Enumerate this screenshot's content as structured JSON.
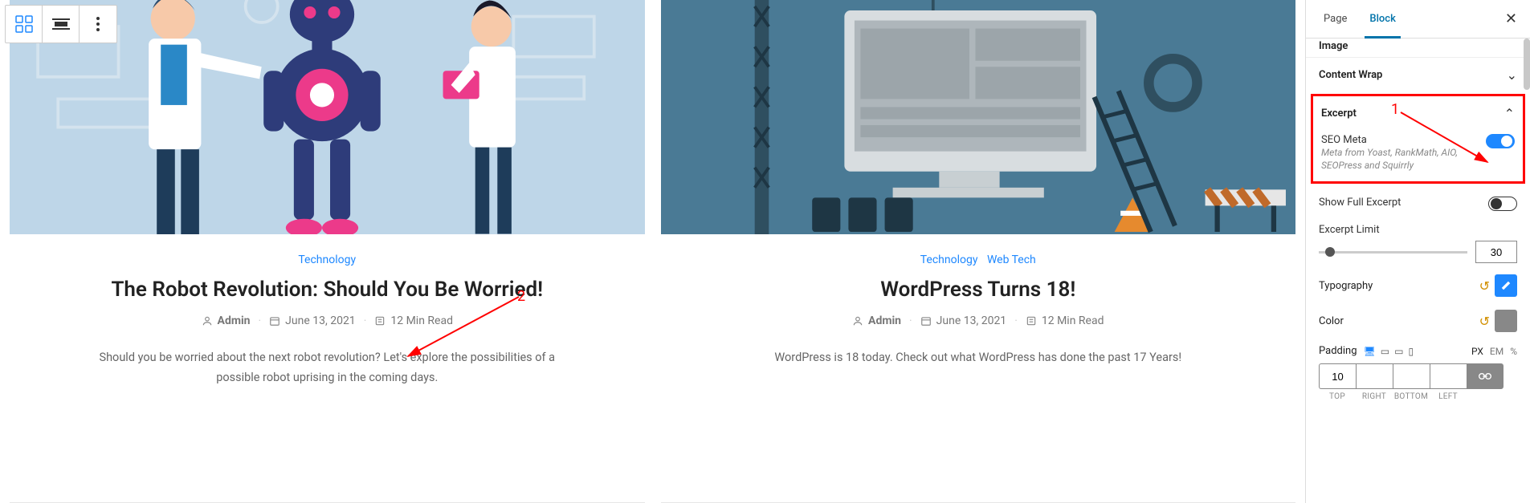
{
  "toolbar": {
    "grid_view": "grid-blocks-icon",
    "fill_view": "fill-width-icon",
    "more": "more-options-icon"
  },
  "posts": [
    {
      "categories": [
        "Technology"
      ],
      "title": "The Robot Revolution: Should You Be Worried!",
      "author": "Admin",
      "date": "June 13, 2021",
      "read_time": "12 Min Read",
      "excerpt": "Should you be worried about the next robot revolution? Let's explore the possibilities of a possible robot uprising in the coming days."
    },
    {
      "categories": [
        "Technology",
        "Web Tech"
      ],
      "title": "WordPress Turns 18!",
      "author": "Admin",
      "date": "June 13, 2021",
      "read_time": "12 Min Read",
      "excerpt": "WordPress is 18 today. Check out what WordPress has done the past 17 Years!"
    }
  ],
  "sidebar": {
    "tabs": {
      "page": "Page",
      "block": "Block"
    },
    "sections": {
      "image": "Image",
      "content_wrap": "Content Wrap",
      "excerpt": "Excerpt"
    },
    "seo_meta": {
      "label": "SEO Meta",
      "sub": "Meta from Yoast, RankMath, AIO, SEOPress and Squirrly"
    },
    "show_full": {
      "label": "Show Full Excerpt"
    },
    "excerpt_limit": {
      "label": "Excerpt Limit",
      "value": "30"
    },
    "typography": "Typography",
    "color": "Color",
    "padding": {
      "label": "Padding",
      "units": {
        "px": "PX",
        "em": "EM",
        "pct": "%"
      },
      "top": "10",
      "right": "",
      "bottom": "",
      "left": "",
      "labels": {
        "top": "TOP",
        "right": "RIGHT",
        "bottom": "BOTTOM",
        "left": "LEFT"
      }
    }
  },
  "annotations": {
    "ann1": "1",
    "ann2": "2"
  }
}
